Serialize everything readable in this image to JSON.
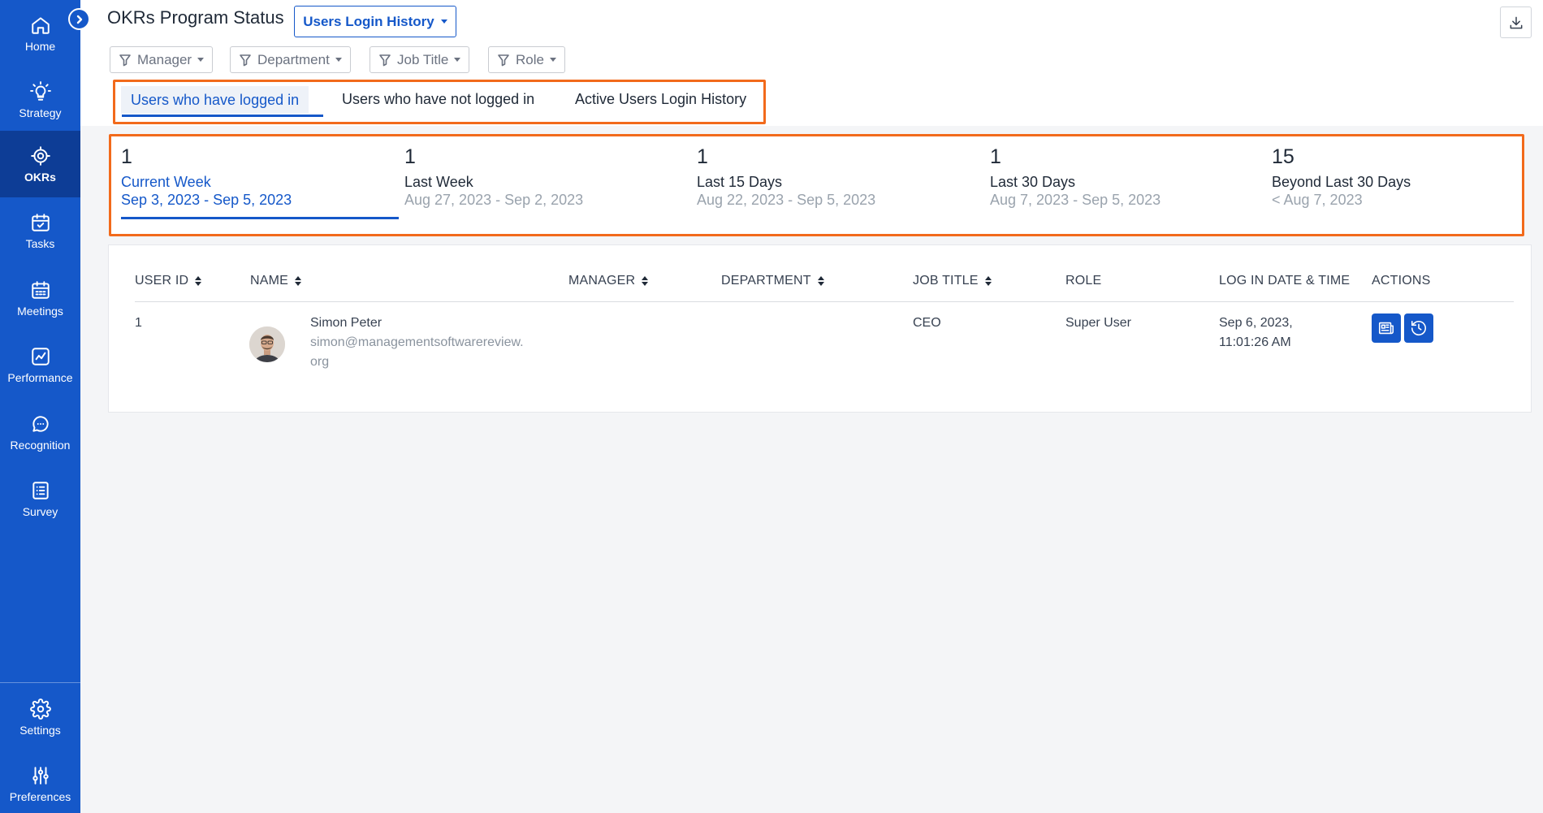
{
  "sidebar": {
    "items": [
      {
        "label": "Home",
        "icon": "home-icon"
      },
      {
        "label": "Strategy",
        "icon": "lightbulb-icon"
      },
      {
        "label": "OKRs",
        "icon": "target-icon",
        "active": true
      },
      {
        "label": "Tasks",
        "icon": "calendar-check-icon"
      },
      {
        "label": "Meetings",
        "icon": "calendar-grid-icon"
      },
      {
        "label": "Performance",
        "icon": "chart-line-icon"
      },
      {
        "label": "Recognition",
        "icon": "chat-bubble-icon"
      },
      {
        "label": "Survey",
        "icon": "list-icon"
      }
    ],
    "bottom_items": [
      {
        "label": "Settings",
        "icon": "gear-icon"
      },
      {
        "label": "Preferences",
        "icon": "sliders-icon"
      }
    ]
  },
  "header": {
    "title": "OKRs Program Status",
    "view_select": "Users Login History"
  },
  "filters": [
    "Manager",
    "Department",
    "Job Title",
    "Role"
  ],
  "tabs": [
    {
      "label": "Users who have logged in",
      "active": true
    },
    {
      "label": "Users who have not logged in"
    },
    {
      "label": "Active Users Login History"
    }
  ],
  "stats": [
    {
      "count": "1",
      "label": "Current Week",
      "range": "Sep 3, 2023 - Sep 5, 2023",
      "active": true
    },
    {
      "count": "1",
      "label": "Last Week",
      "range": "Aug 27, 2023 - Sep 2, 2023"
    },
    {
      "count": "1",
      "label": "Last 15 Days",
      "range": "Aug 22, 2023 - Sep 5, 2023"
    },
    {
      "count": "1",
      "label": "Last 30 Days",
      "range": "Aug 7, 2023 - Sep 5, 2023"
    },
    {
      "count": "15",
      "label": "Beyond Last 30 Days",
      "range": "< Aug 7, 2023"
    }
  ],
  "table": {
    "columns": [
      "USER ID",
      "NAME",
      "MANAGER",
      "DEPARTMENT",
      "JOB TITLE",
      "ROLE",
      "LOG IN DATE & TIME",
      "ACTIONS"
    ],
    "rows": [
      {
        "user_id": "1",
        "name": "Simon Peter",
        "email_line1": "simon@managementsoftwarereview.",
        "email_line2": "org",
        "manager": "",
        "department": "",
        "job_title": "CEO",
        "role": "Super User",
        "login_line1": "Sep 6, 2023,",
        "login_line2": "11:01:26 AM"
      }
    ]
  },
  "colors": {
    "sidebar": "#1558c9",
    "sidebar_active": "#0d3d96",
    "accent": "#1558c9",
    "highlight_border": "#f26a1b"
  }
}
